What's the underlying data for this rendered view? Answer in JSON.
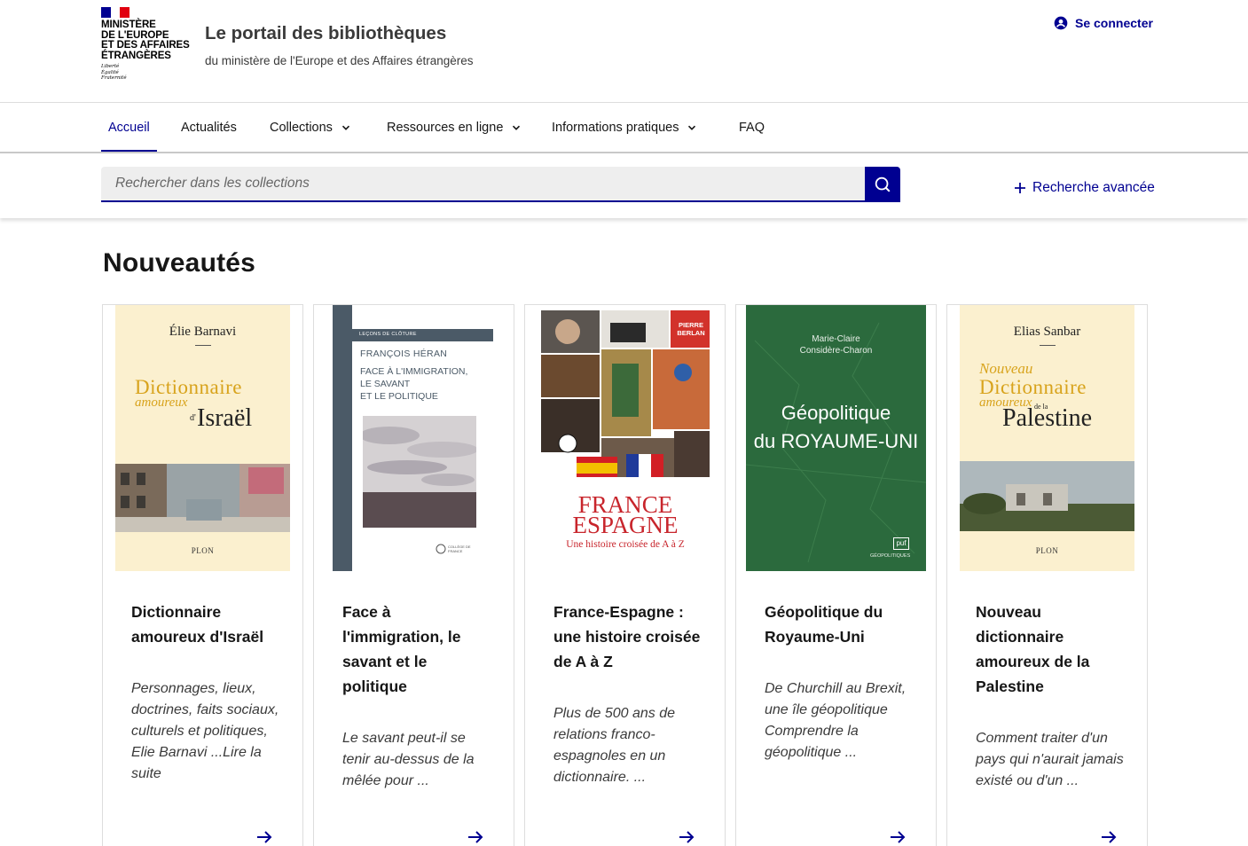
{
  "header": {
    "logo_text": "MINISTÈRE\nDE L'EUROPE\nET DES AFFAIRES\nÉTRANGÈRES",
    "logo_motto": "Liberté\nÉgalité\nFraternité",
    "service_title": "Le portail des bibliothèques",
    "service_tagline": "du ministère de l'Europe et des Affaires étrangères",
    "login_label": "Se connecter"
  },
  "nav": {
    "items": [
      {
        "label": "Accueil"
      },
      {
        "label": "Actualités"
      },
      {
        "label": "Collections"
      },
      {
        "label": "Ressources en ligne"
      },
      {
        "label": "Informations pratiques"
      },
      {
        "label": "FAQ"
      }
    ]
  },
  "search": {
    "placeholder": "Rechercher dans les collections",
    "advanced_label": "Recherche avancée"
  },
  "section": {
    "title": "Nouveautés"
  },
  "books": [
    {
      "title": "Dictionnaire amoureux d'Israël",
      "description": "Personnages, lieux, doctrines, faits sociaux, culturels et politiques, Elie Barnavi ...Lire la suite",
      "cover": {
        "author": "Élie Barnavi",
        "line1": "Dictionnaire",
        "line2": "amoureux",
        "line3a": "d'",
        "line3": "Israël",
        "publisher": "PLON"
      }
    },
    {
      "title": "Face à l'immigration, le savant et le politique",
      "description": "Le savant peut-il se tenir au-dessus de la mêlée pour ...",
      "cover": {
        "band": "LEÇONS DE CLÔTURE",
        "author": "FRANÇOIS HÉRAN",
        "title_lines": "FACE À L'IMMIGRATION,\nLE SAVANT\nET LE POLITIQUE",
        "publisher": "COLLÈGE DE FRANCE"
      }
    },
    {
      "title": "France-Espagne : une histoire croisée de A à Z",
      "description": "Plus de 500 ans de relations franco-espagnoles en un dictionnaire. ...",
      "cover": {
        "author": "PIERRE BERLAN",
        "line1": "FRANCE",
        "line2": "ESPAGNE",
        "subtitle": "Une histoire croisée de A à Z"
      }
    },
    {
      "title": "Géopolitique du Royaume-Uni",
      "description": "De Churchill au Brexit, une île géopolitique Comprendre la géopolitique ...",
      "cover": {
        "author": "Marie-Claire\nConsidère-Charon",
        "title_lines": "Géopolitique\ndu ROYAUME-UNI",
        "publisher": "puf",
        "collection": "GÉOPOLITIQUES"
      }
    },
    {
      "title": "Nouveau dictionnaire amoureux de la Palestine",
      "description": "Comment traiter d'un pays qui n'aurait jamais existé ou d'un ...",
      "cover": {
        "author": "Elias Sanbar",
        "line0": "Nouveau",
        "line1": "Dictionnaire",
        "line2": "amoureux",
        "line3a": "de la",
        "line3": "Palestine",
        "publisher": "PLON"
      }
    }
  ],
  "colors": {
    "primary": "#000091",
    "flag_blue": "#000091",
    "flag_white": "#ffffff",
    "flag_red": "#e1000f",
    "text": "#161616",
    "muted": "#3a3a3a",
    "search_bg": "#eeeeee"
  },
  "icons": {
    "login": "user-circle-icon",
    "search": "search-icon",
    "advanced": "plus-icon",
    "chevron": "chevron-down-icon",
    "card_link": "arrow-right-icon"
  }
}
